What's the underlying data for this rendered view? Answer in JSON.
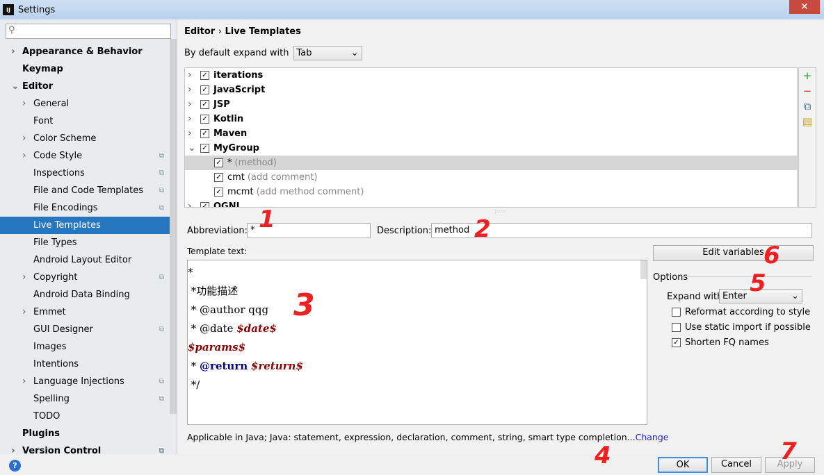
{
  "window": {
    "title": "Settings",
    "logo": "IJ",
    "close": "✕"
  },
  "search": {
    "placeholder": "",
    "icon": "search-icon"
  },
  "sidebar": {
    "items": [
      {
        "label": "Appearance & Behavior",
        "level": 0,
        "bold": true,
        "arrow": "right"
      },
      {
        "label": "Keymap",
        "level": 0,
        "bold": true
      },
      {
        "label": "Editor",
        "level": 0,
        "bold": true,
        "arrow": "down"
      },
      {
        "label": "General",
        "level": 1,
        "arrow": "right"
      },
      {
        "label": "Font",
        "level": 1
      },
      {
        "label": "Color Scheme",
        "level": 1,
        "arrow": "right"
      },
      {
        "label": "Code Style",
        "level": 1,
        "arrow": "right",
        "copy": true
      },
      {
        "label": "Inspections",
        "level": 1,
        "copy": true
      },
      {
        "label": "File and Code Templates",
        "level": 1,
        "copy": true
      },
      {
        "label": "File Encodings",
        "level": 1,
        "copy": true
      },
      {
        "label": "Live Templates",
        "level": 1,
        "selected": true
      },
      {
        "label": "File Types",
        "level": 1
      },
      {
        "label": "Android Layout Editor",
        "level": 1
      },
      {
        "label": "Copyright",
        "level": 1,
        "arrow": "right",
        "copy": true
      },
      {
        "label": "Android Data Binding",
        "level": 1
      },
      {
        "label": "Emmet",
        "level": 1,
        "arrow": "right"
      },
      {
        "label": "GUI Designer",
        "level": 1,
        "copy": true
      },
      {
        "label": "Images",
        "level": 1
      },
      {
        "label": "Intentions",
        "level": 1
      },
      {
        "label": "Language Injections",
        "level": 1,
        "arrow": "right",
        "copy": true
      },
      {
        "label": "Spelling",
        "level": 1,
        "copy": true
      },
      {
        "label": "TODO",
        "level": 1
      },
      {
        "label": "Plugins",
        "level": 0,
        "bold": true
      },
      {
        "label": "Version Control",
        "level": 0,
        "bold": true,
        "arrow": "right",
        "copy": true
      }
    ]
  },
  "breadcrumb": {
    "parent": "Editor",
    "sep": "›",
    "current": "Live Templates"
  },
  "expand_default": {
    "label": "By default expand with",
    "value": "Tab"
  },
  "tree": {
    "rows": [
      {
        "label": "iterations",
        "group": true,
        "arrow": "right"
      },
      {
        "label": "JavaScript",
        "group": true,
        "arrow": "right"
      },
      {
        "label": "JSP",
        "group": true,
        "arrow": "right"
      },
      {
        "label": "Kotlin",
        "group": true,
        "arrow": "right"
      },
      {
        "label": "Maven",
        "group": true,
        "arrow": "right"
      },
      {
        "label": "MyGroup",
        "group": true,
        "arrow": "down"
      },
      {
        "label": "*",
        "desc": "(method)",
        "selected": true
      },
      {
        "label": "cmt",
        "desc": "(add comment)"
      },
      {
        "label": "mcmt",
        "desc": "(add method comment)"
      },
      {
        "label": "OGNL",
        "group": true,
        "arrow": "right"
      }
    ]
  },
  "tools": [
    "+",
    "−",
    "⧉",
    "▤"
  ],
  "abbreviation": {
    "label": "Abbreviation:",
    "value": "*"
  },
  "description": {
    "label": "Description:",
    "value": "method"
  },
  "template": {
    "label": "Template text:",
    "lines": [
      [
        {
          "t": "*"
        }
      ],
      [
        {
          "t": " *功能描述"
        }
      ],
      [
        {
          "t": " * @author qqg"
        }
      ],
      [
        {
          "t": " * @date "
        },
        {
          "t": "$date$",
          "c": "var"
        }
      ],
      [
        {
          "t": "$params$",
          "c": "var"
        }
      ],
      [
        {
          "t": " * "
        },
        {
          "t": "@return",
          "c": "kw"
        },
        {
          "t": " "
        },
        {
          "t": "$return$",
          "c": "var"
        }
      ],
      [
        {
          "t": " */"
        }
      ]
    ]
  },
  "edit_variables": "Edit variables",
  "options": {
    "title": "Options",
    "expand_label": "Expand with",
    "expand_value": "Enter",
    "checks": [
      {
        "label": "Reformat according to style",
        "checked": false
      },
      {
        "label": "Use static import if possible",
        "checked": false
      },
      {
        "label": "Shorten FQ names",
        "checked": true
      }
    ]
  },
  "applicable": {
    "text": "Applicable in Java; Java: statement, expression, declaration, comment, string, smart type completion...",
    "link": "Change"
  },
  "buttons": {
    "ok": "OK",
    "cancel": "Cancel",
    "apply": "Apply",
    "help": "?"
  },
  "annotations": [
    "1",
    "2",
    "3",
    "4",
    "5",
    "6",
    "7"
  ]
}
